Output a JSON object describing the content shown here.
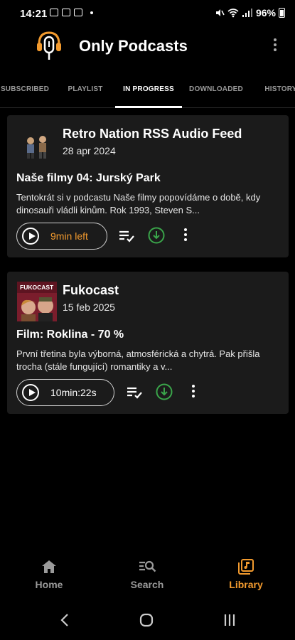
{
  "status_bar": {
    "time": "14:21",
    "battery": "96%"
  },
  "app": {
    "title": "Only Podcasts"
  },
  "tabs": [
    {
      "label": "SUBSCRIBED",
      "active": false
    },
    {
      "label": "PLAYLIST",
      "active": false
    },
    {
      "label": "IN PROGRESS",
      "active": true
    },
    {
      "label": "DOWNLOADED",
      "active": false
    },
    {
      "label": "HISTORY",
      "active": false
    }
  ],
  "episodes": [
    {
      "podcast": "Retro Nation RSS Audio Feed",
      "date": "28 apr 2024",
      "title": "Naše filmy 04: Jurský Park",
      "description": "Tentokrát si v podcastu Naše filmy popovídáme o době, kdy dinosauři vládli kinům. Rok 1993, Steven S...",
      "play_label": "9min left",
      "play_color": "#f29a2e"
    },
    {
      "podcast": "Fukocast",
      "date": "15 feb 2025",
      "title": "Film: Roklina - 70 %",
      "description": "První třetina byla výborná, atmosférická a chytrá. Pak přišla trocha (stále fungující) romantiky a v...",
      "play_label": "10min:22s",
      "play_color": "#ffffff",
      "art_text": "FUKOCAST"
    }
  ],
  "bottom_nav": [
    {
      "label": "Home",
      "icon": "home-icon",
      "active": false
    },
    {
      "label": "Search",
      "icon": "search-icon",
      "active": false
    },
    {
      "label": "Library",
      "icon": "library-icon",
      "active": true
    }
  ],
  "colors": {
    "accent": "#f29a2e",
    "download": "#3aa54a",
    "card": "#1b1b1b",
    "background": "#000000"
  }
}
